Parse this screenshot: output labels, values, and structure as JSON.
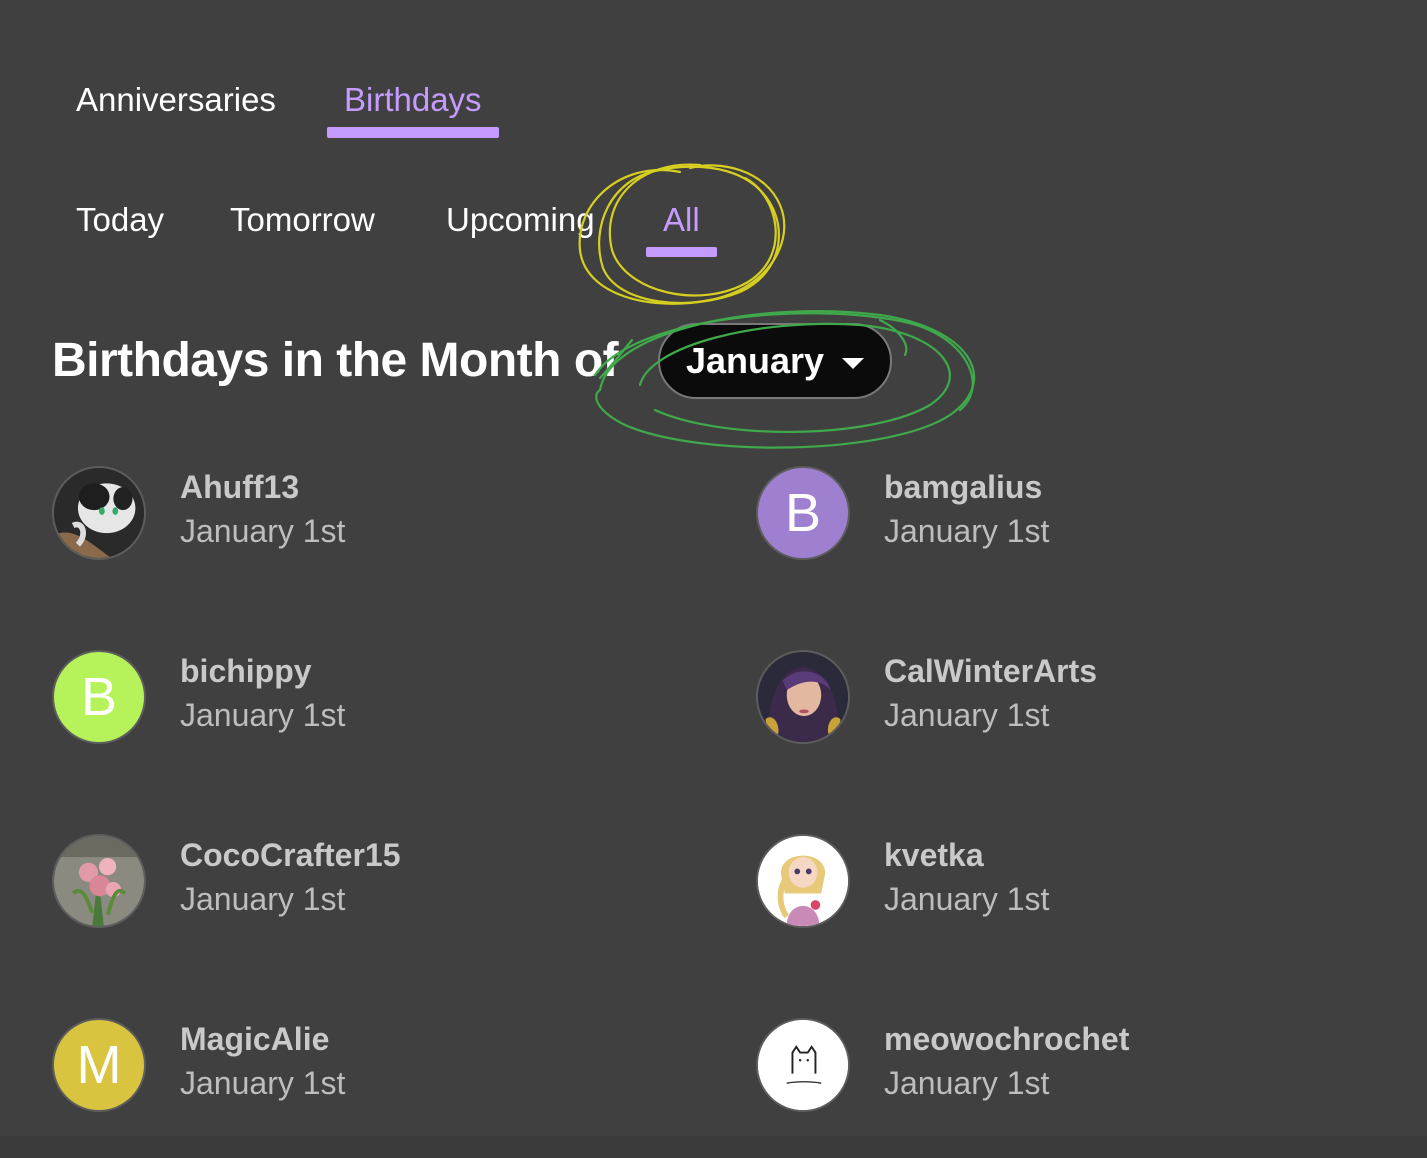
{
  "primary_tabs": [
    {
      "label": "Anniversaries",
      "active": false
    },
    {
      "label": "Birthdays",
      "active": true
    }
  ],
  "sub_tabs": [
    {
      "label": "Today",
      "active": false
    },
    {
      "label": "Tomorrow",
      "active": false
    },
    {
      "label": "Upcoming",
      "active": false
    },
    {
      "label": "All",
      "active": true
    }
  ],
  "heading": "Birthdays in the Month of",
  "month_select": {
    "value": "January",
    "icon": "caret-down-icon"
  },
  "colors": {
    "background": "#404040",
    "accent": "#c69bff",
    "annotation_yellow": "#d6cf1f",
    "annotation_green": "#3fa94b"
  },
  "birthdays": [
    {
      "name": "Ahuff13",
      "date": "January 1st",
      "avatar": "cat-photo-avatar"
    },
    {
      "name": "bamgalius",
      "date": "January 1st",
      "avatar": "initial",
      "initial": "B",
      "color": "#9f7fd0"
    },
    {
      "name": "bichippy",
      "date": "January 1st",
      "avatar": "initial",
      "initial": "B",
      "color": "#b6f35a"
    },
    {
      "name": "CalWinterArts",
      "date": "January 1st",
      "avatar": "portrait-photo-avatar"
    },
    {
      "name": "CocoCrafter15",
      "date": "January 1st",
      "avatar": "flowers-photo-avatar"
    },
    {
      "name": "kvetka",
      "date": "January 1st",
      "avatar": "doll-illustration-avatar"
    },
    {
      "name": "MagicAlie",
      "date": "January 1st",
      "avatar": "initial",
      "initial": "M",
      "color": "#d8c43f"
    },
    {
      "name": "meowochrochet",
      "date": "January 1st",
      "avatar": "cat-logo-avatar"
    }
  ]
}
